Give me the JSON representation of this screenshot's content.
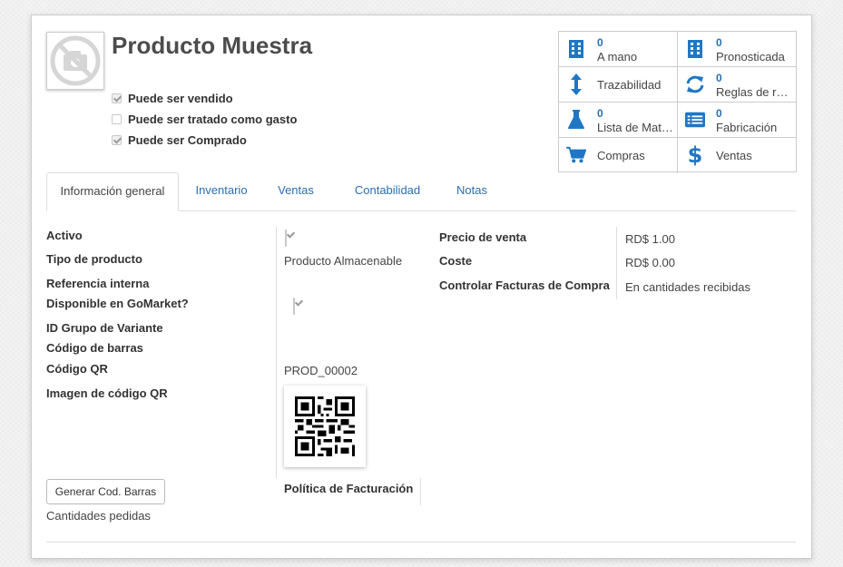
{
  "product": {
    "title": "Producto Muestra",
    "checkboxes": [
      {
        "label": "Puede ser vendido",
        "checked": true
      },
      {
        "label": "Puede ser tratado como gasto",
        "checked": false
      },
      {
        "label": "Puede ser Comprado",
        "checked": true
      }
    ]
  },
  "smart_buttons": [
    {
      "icon": "building-icon",
      "count": "0",
      "label": "A mano"
    },
    {
      "icon": "building-icon",
      "count": "0",
      "label": "Pronosticada"
    },
    {
      "icon": "arrows-vertical-icon",
      "count": "",
      "label": "Trazabilidad"
    },
    {
      "icon": "refresh-icon",
      "count": "0",
      "label": "Reglas de re…"
    },
    {
      "icon": "flask-icon",
      "count": "0",
      "label": "Lista de Mat…"
    },
    {
      "icon": "list-icon",
      "count": "0",
      "label": "Fabricación"
    },
    {
      "icon": "cart-icon",
      "count": "",
      "label": "Compras"
    },
    {
      "icon": "dollar-icon",
      "count": "",
      "label": "Ventas"
    }
  ],
  "tabs": [
    "Información general",
    "Inventario",
    "Ventas",
    "Contabilidad",
    "Notas"
  ],
  "left_fields": {
    "activo": {
      "label": "Activo"
    },
    "tipo": {
      "label": "Tipo de producto",
      "value": "Producto Almacenable"
    },
    "referencia": {
      "label": "Referencia interna"
    },
    "gomarket": {
      "label": "Disponible en GoMarket?"
    },
    "id_grupo": {
      "label": "ID Grupo de Variante"
    },
    "barras": {
      "label": "Código de barras"
    },
    "qr": {
      "label": "Código QR",
      "value": "PROD_00002"
    },
    "qr_imagen": {
      "label": "Imagen de código QR"
    }
  },
  "right_fields": {
    "precio": {
      "label": "Precio de venta",
      "value": "RD$ 1.00"
    },
    "coste": {
      "label": "Coste",
      "value": "RD$ 0.00"
    },
    "control": {
      "label": "Controlar Facturas de Compra",
      "value": "En cantidades recibidas"
    }
  },
  "politica_label": "Política de Facturación",
  "generate_button": "Generar Cod. Barras",
  "cantidades_label": "Cantidades pedidas",
  "colors": {
    "accent": "#2a6fb0",
    "icon_blue": "#1f77c4"
  }
}
